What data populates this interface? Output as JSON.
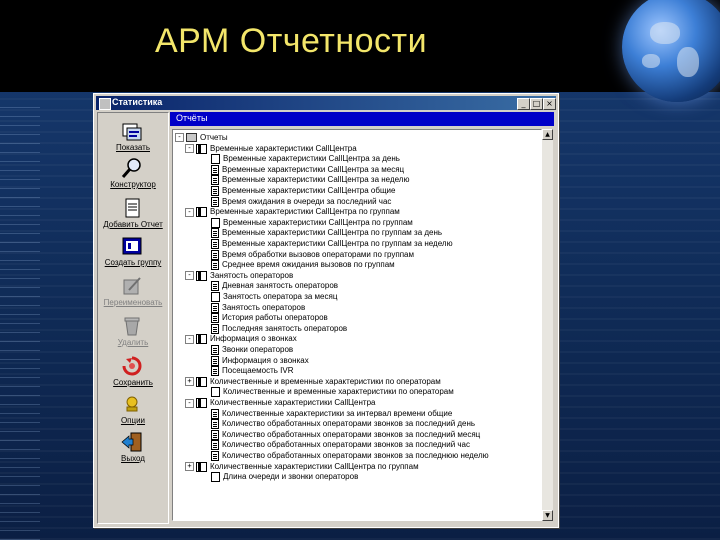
{
  "slide": {
    "title": "АРМ Отчетности"
  },
  "window": {
    "title": "Статистика",
    "buttons": {
      "minimize": "_",
      "maximize": "□",
      "close": "×"
    }
  },
  "toolbar": {
    "items": [
      {
        "label": "Показать",
        "icon": "report-icon",
        "disabled": false
      },
      {
        "label": "Конструктор",
        "icon": "magnifier-icon",
        "disabled": false
      },
      {
        "label": "Добавить Отчет",
        "icon": "add-report-icon",
        "disabled": false
      },
      {
        "label": "Создать группу",
        "icon": "create-group-icon",
        "disabled": false
      },
      {
        "label": "Переименовать",
        "icon": "rename-icon",
        "disabled": true
      },
      {
        "label": "Удалить",
        "icon": "trash-icon",
        "disabled": true
      },
      {
        "label": "Сохранить",
        "icon": "save-icon",
        "disabled": false
      },
      {
        "label": "Опции",
        "icon": "options-icon",
        "disabled": false
      },
      {
        "label": "Выход",
        "icon": "exit-icon",
        "disabled": false
      }
    ]
  },
  "panel": {
    "title": "Отчёты"
  },
  "tree": [
    {
      "level": 0,
      "icon": "folder",
      "expander": "-",
      "text": "Отчеты"
    },
    {
      "level": 1,
      "icon": "book",
      "expander": "-",
      "text": "Временные характеристики CallЦентра"
    },
    {
      "level": 2,
      "icon": "page",
      "text": "Временные характеристики CallЦентра за день"
    },
    {
      "level": 2,
      "icon": "doc",
      "text": "Временные характеристики CallЦентра за месяц"
    },
    {
      "level": 2,
      "icon": "doc",
      "text": "Временные характеристики CallЦентра за неделю"
    },
    {
      "level": 2,
      "icon": "doc",
      "text": "Временные характеристики CallЦентра общие"
    },
    {
      "level": 2,
      "icon": "doc",
      "text": "Время ожидания в очереди за последний час"
    },
    {
      "level": 1,
      "icon": "book",
      "expander": "-",
      "text": "Временные характеристики CallЦентра по группам"
    },
    {
      "level": 2,
      "icon": "page",
      "text": "Временные характеристики CallЦентра по группам"
    },
    {
      "level": 2,
      "icon": "doc",
      "text": "Временные характеристики CallЦентра по группам за день"
    },
    {
      "level": 2,
      "icon": "doc",
      "text": "Временные характеристики CallЦентра по группам за неделю"
    },
    {
      "level": 2,
      "icon": "doc",
      "text": "Время обработки вызовов операторами по группам"
    },
    {
      "level": 2,
      "icon": "doc",
      "text": "Среднее время ожидания вызовов по группам"
    },
    {
      "level": 1,
      "icon": "book",
      "expander": "-",
      "text": "Занятость операторов"
    },
    {
      "level": 2,
      "icon": "doc",
      "text": "Дневная занятость операторов"
    },
    {
      "level": 2,
      "icon": "page",
      "text": "Занятость оператора за месяц"
    },
    {
      "level": 2,
      "icon": "doc",
      "text": "Занятость операторов"
    },
    {
      "level": 2,
      "icon": "doc",
      "text": "История работы операторов"
    },
    {
      "level": 2,
      "icon": "doc",
      "text": "Последняя занятость операторов"
    },
    {
      "level": 1,
      "icon": "book",
      "expander": "-",
      "text": "Информация о звонках"
    },
    {
      "level": 2,
      "icon": "doc",
      "text": "Звонки операторов"
    },
    {
      "level": 2,
      "icon": "doc",
      "text": "Информация о звонках"
    },
    {
      "level": 2,
      "icon": "doc",
      "text": "Посещаемость IVR"
    },
    {
      "level": 1,
      "icon": "book",
      "expander": "+",
      "text": "Количественные и временные характеристики по операторам"
    },
    {
      "level": 2,
      "icon": "page",
      "text": "Количественные и временные характеристики по операторам"
    },
    {
      "level": 1,
      "icon": "book",
      "expander": "-",
      "text": "Количественные характеристики CallЦентра"
    },
    {
      "level": 2,
      "icon": "doc",
      "text": "Количественные характеристики за интервал времени общие"
    },
    {
      "level": 2,
      "icon": "doc",
      "text": "Количество обработанных операторами звонков за последний день"
    },
    {
      "level": 2,
      "icon": "doc",
      "text": "Количество обработанных операторами звонков за последний месяц"
    },
    {
      "level": 2,
      "icon": "doc",
      "text": "Количество обработанных операторами звонков за последний час"
    },
    {
      "level": 2,
      "icon": "doc",
      "text": "Количество обработанных операторами звонков за последнюю неделю"
    },
    {
      "level": 1,
      "icon": "book",
      "expander": "+",
      "text": "Количественные характеристики CallЦентра по группам"
    },
    {
      "level": 2,
      "icon": "page",
      "text": "Длина очереди и звонки операторов"
    }
  ]
}
